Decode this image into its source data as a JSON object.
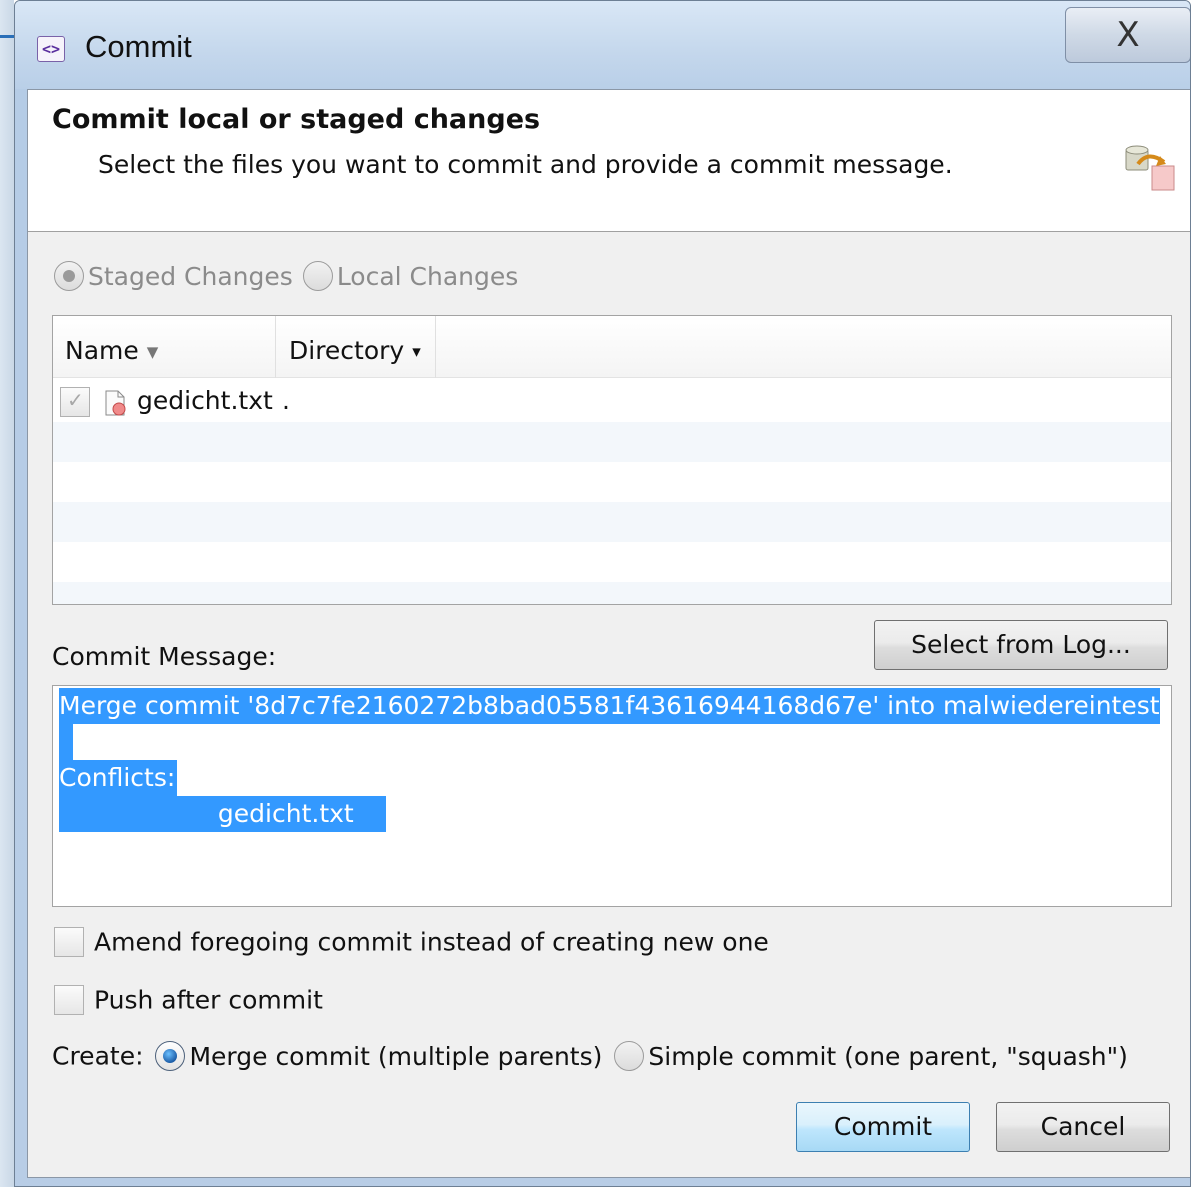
{
  "window": {
    "title": "Commit",
    "close_glyph": "X",
    "icon": "window-app-icon"
  },
  "header": {
    "title": "Commit local or staged changes",
    "description": "Select the files you want to commit and provide a commit message.",
    "icon": "commit-header-icon"
  },
  "changes_mode": {
    "options": [
      "Staged Changes",
      "Local Changes"
    ],
    "selected": "Staged Changes"
  },
  "files_table": {
    "columns": [
      {
        "label": "Name",
        "sort_glyph": "▼"
      },
      {
        "label": "Directory",
        "sort_glyph": "▾"
      }
    ],
    "rows": [
      {
        "checked": true,
        "icon": "conflict-file-icon",
        "name": "gedicht.txt",
        "directory": "."
      }
    ]
  },
  "commit_message": {
    "label": "Commit Message:",
    "lines": [
      "Merge commit '8d7c7fe2160272b8bad05581f43616944168d67e' into malwiedereintest",
      "",
      "Conflicts:",
      "                    gedicht.txt"
    ],
    "select_from_log_label": "Select from Log..."
  },
  "options": {
    "amend_label": "Amend foregoing commit instead of creating new one",
    "amend_checked": false,
    "push_label": "Push after commit",
    "push_checked": false
  },
  "create": {
    "label": "Create:",
    "options": [
      "Merge commit (multiple parents)",
      "Simple commit (one parent, \"squash\")"
    ],
    "selected": "Merge commit (multiple parents)"
  },
  "buttons": {
    "commit": "Commit",
    "cancel": "Cancel"
  },
  "colors": {
    "selection": "#3399ff",
    "default_button_border": "#3c7fb1"
  }
}
